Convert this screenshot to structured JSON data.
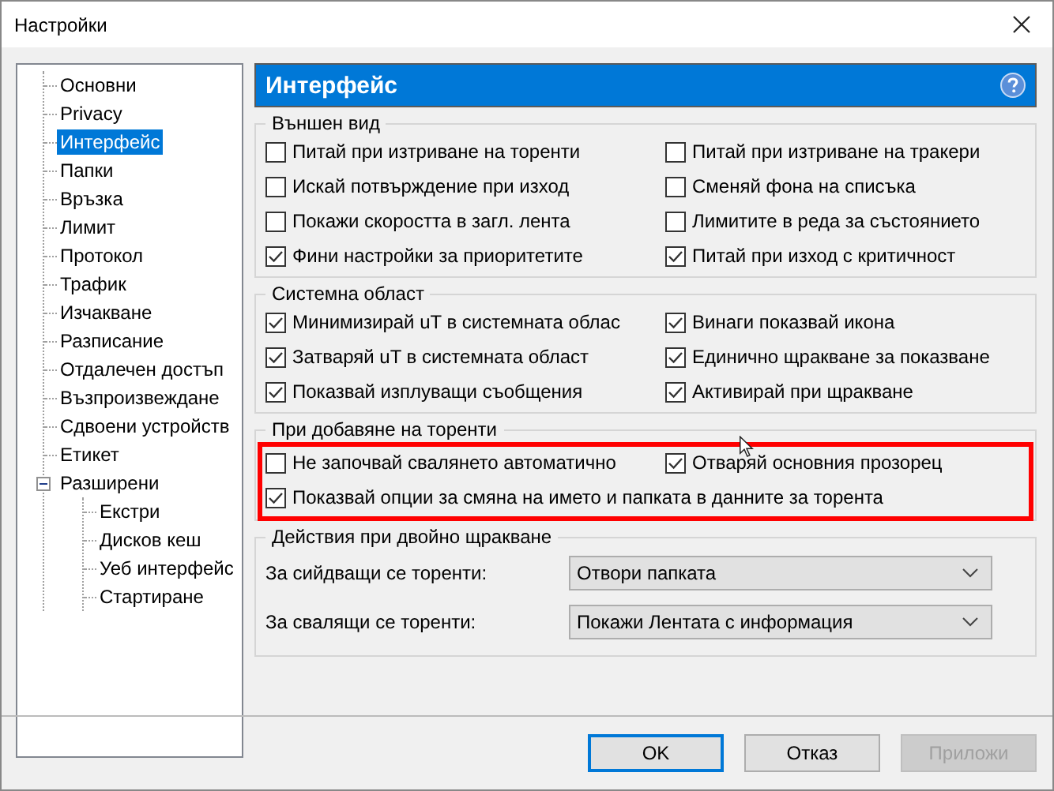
{
  "window": {
    "title": "Настройки"
  },
  "sidebar": {
    "items": [
      {
        "label": "Основни",
        "selected": false
      },
      {
        "label": "Privacy",
        "selected": false
      },
      {
        "label": "Интерфейс",
        "selected": true
      },
      {
        "label": "Папки",
        "selected": false
      },
      {
        "label": "Връзка",
        "selected": false
      },
      {
        "label": "Лимит",
        "selected": false
      },
      {
        "label": "Протокол",
        "selected": false
      },
      {
        "label": "Трафик",
        "selected": false
      },
      {
        "label": "Изчакване",
        "selected": false
      },
      {
        "label": "Разписание",
        "selected": false
      },
      {
        "label": "Отдалечен достъп",
        "selected": false
      },
      {
        "label": "Възпроизвеждане",
        "selected": false
      },
      {
        "label": "Сдвоени устройств",
        "selected": false
      },
      {
        "label": "Етикет",
        "selected": false
      },
      {
        "label": "Разширени",
        "selected": false,
        "expanded": true,
        "children": [
          {
            "label": "Екстри",
            "selected": false
          },
          {
            "label": "Дисков кеш",
            "selected": false
          },
          {
            "label": "Уеб интерфейс",
            "selected": false
          },
          {
            "label": "Стартиране",
            "selected": false
          }
        ]
      }
    ]
  },
  "panel": {
    "title": "Интерфейс"
  },
  "groups": [
    {
      "title": "Външен вид",
      "highlighted": false,
      "options": [
        {
          "label": "Питай при изтриване на торенти",
          "checked": false
        },
        {
          "label": "Питай при изтриване на тракери",
          "checked": false
        },
        {
          "label": "Искай потвърждение при изход",
          "checked": false
        },
        {
          "label": "Сменяй фона на списъка",
          "checked": false
        },
        {
          "label": "Покажи скоростта в загл. лента",
          "checked": false
        },
        {
          "label": "Лимитите в реда за състоянието",
          "checked": false
        },
        {
          "label": "Фини настройки за приоритетите",
          "checked": true
        },
        {
          "label": "Питай при изход с критичност",
          "checked": true
        }
      ]
    },
    {
      "title": "Системна област",
      "highlighted": false,
      "options": [
        {
          "label": "Минимизирай uT в системната облас",
          "checked": true
        },
        {
          "label": "Винаги показвай икона",
          "checked": true
        },
        {
          "label": "Затваряй uT в системната област",
          "checked": true
        },
        {
          "label": "Единично щракване за показване",
          "checked": true
        },
        {
          "label": "Показвай изплуващи съобщения",
          "checked": true
        },
        {
          "label": "Активирай при щракване",
          "checked": true
        }
      ]
    },
    {
      "title": "При добавяне на торенти",
      "highlighted": true,
      "options": [
        {
          "label": "Не започвай свалянето автоматично",
          "checked": false
        },
        {
          "label": "Отваряй основния прозорец",
          "checked": true
        },
        {
          "label": "Показвай опции за смяна на името и папката в данните за торента",
          "checked": true,
          "wide": true
        }
      ]
    }
  ],
  "double_click": {
    "title": "Действия при двойно щракване",
    "rows": [
      {
        "label": "За сийдващи се торенти:",
        "value": "Отвори папката"
      },
      {
        "label": "За свалящи се торенти:",
        "value": "Покажи Лентата с информация"
      }
    ]
  },
  "buttons": [
    {
      "label": "OK",
      "default": true,
      "disabled": false
    },
    {
      "label": "Отказ",
      "default": false,
      "disabled": false
    },
    {
      "label": "Приложи",
      "default": false,
      "disabled": true
    }
  ]
}
